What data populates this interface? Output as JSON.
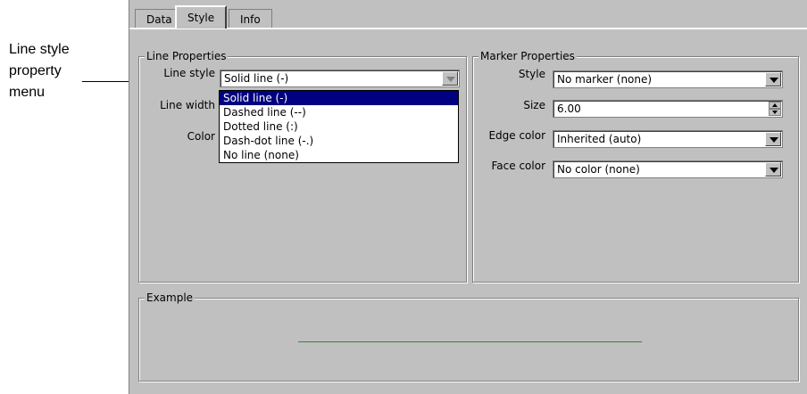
{
  "callout": {
    "lines": [
      "Line style",
      "property",
      "menu"
    ]
  },
  "tabs": [
    {
      "label": "Data",
      "active": false
    },
    {
      "label": "Style",
      "active": true
    },
    {
      "label": "Info",
      "active": false
    }
  ],
  "line_properties": {
    "title": "Line Properties",
    "line_style_label": "Line style",
    "line_style_value": "Solid line (-)",
    "line_width_label": "Line width",
    "color_label": "Color",
    "line_style_options": [
      "Solid line (-)",
      "Dashed line (--)",
      "Dotted line (:)",
      "Dash-dot line (-.)",
      "No line (none)"
    ],
    "selected_index": 0
  },
  "marker_properties": {
    "title": "Marker Properties",
    "style_label": "Style",
    "style_value": "No marker (none)",
    "size_label": "Size",
    "size_value": "6.00",
    "edge_color_label": "Edge color",
    "edge_color_value": "Inherited (auto)",
    "face_color_label": "Face color",
    "face_color_value": "No color (none)"
  },
  "example": {
    "title": "Example",
    "line_color": "#2e8b2e"
  },
  "colors": {
    "panel": "#c0c0c0",
    "selection": "#000080"
  }
}
